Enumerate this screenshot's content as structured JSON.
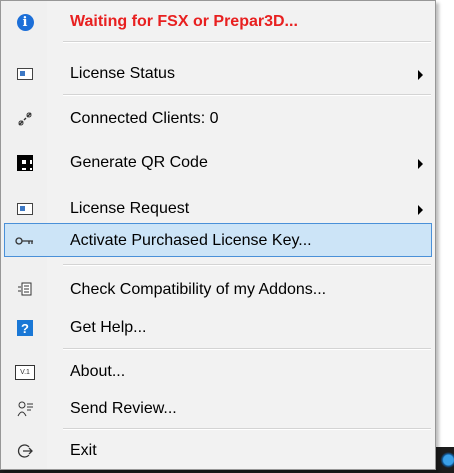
{
  "menu": {
    "items": [
      {
        "icon": "info-icon",
        "label": "Waiting for FSX or Prepar3D...",
        "submenu": false,
        "alert": true
      },
      {
        "icon": "license-status-icon",
        "label": "License Status",
        "submenu": true
      },
      {
        "icon": "connected-clients-icon",
        "label": "Connected Clients: 0",
        "submenu": false
      },
      {
        "icon": "qr-code-icon",
        "label": "Generate QR Code",
        "submenu": true
      },
      {
        "icon": "license-request-icon",
        "label": "License Request",
        "submenu": true
      },
      {
        "icon": "key-icon",
        "label": "Activate Purchased License Key...",
        "submenu": false,
        "highlighted": true
      },
      {
        "icon": "compatibility-icon",
        "label": "Check Compatibility of my Addons...",
        "submenu": false
      },
      {
        "icon": "help-icon",
        "label": "Get Help...",
        "submenu": false
      },
      {
        "icon": "version-icon",
        "label": "About...",
        "submenu": false
      },
      {
        "icon": "review-icon",
        "label": "Send Review...",
        "submenu": false
      },
      {
        "icon": "exit-icon",
        "label": "Exit",
        "submenu": false
      }
    ],
    "icon_glyphs": {
      "info": "i",
      "help": "?",
      "version": "V.1"
    },
    "colors": {
      "alert_text": "#e82020",
      "highlight_bg": "#cce4f7",
      "highlight_border": "#4a90d8",
      "info_icon": "#1c6fd8"
    }
  }
}
